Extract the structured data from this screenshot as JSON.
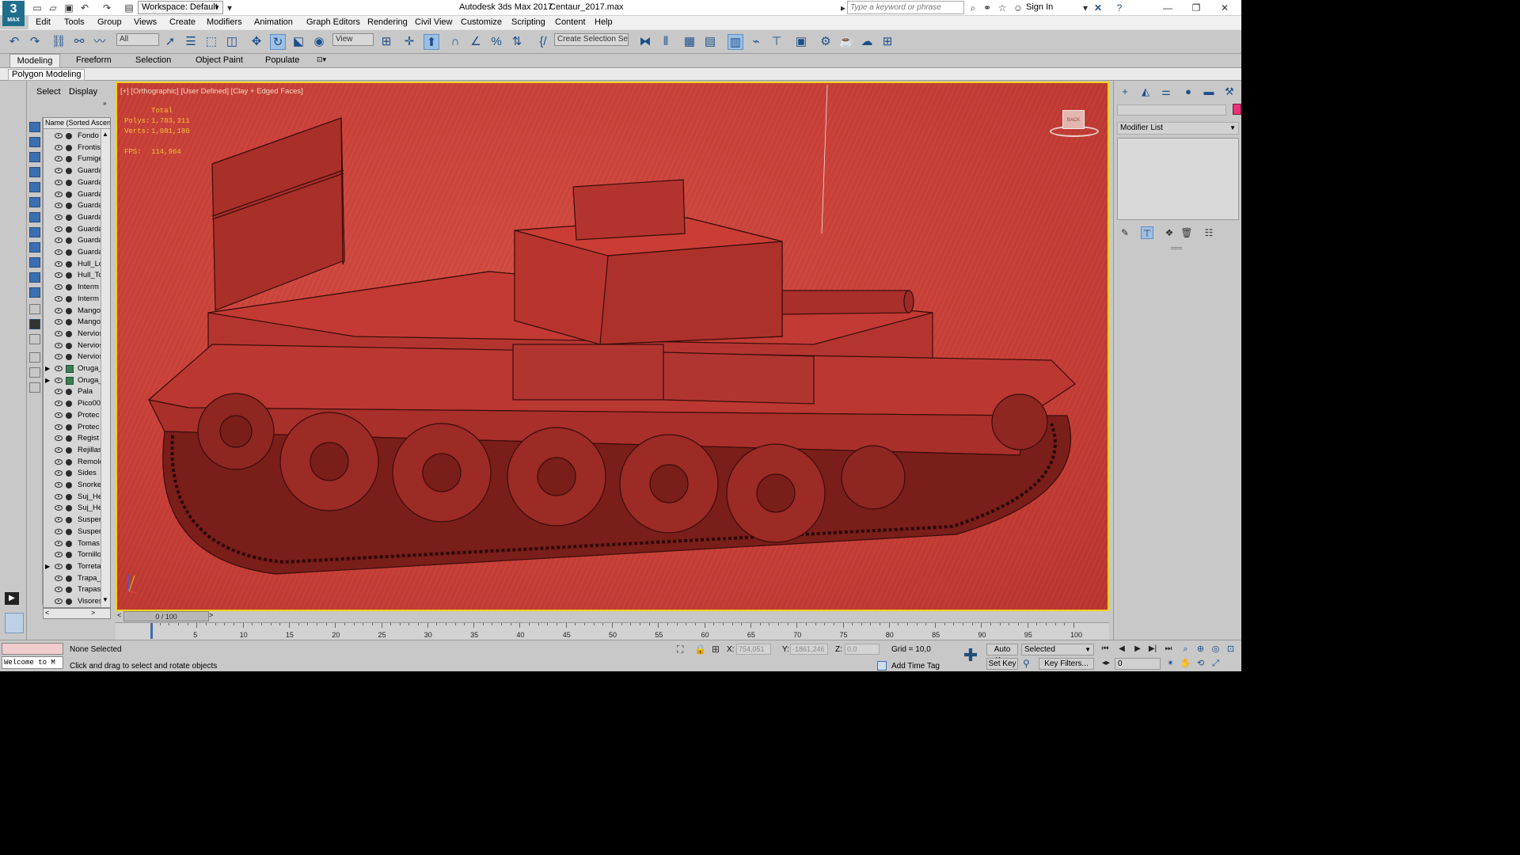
{
  "titlebar": {
    "logo_text": "3",
    "logo_sub": "MAX",
    "workspace": "Workspace: Default",
    "app_title": "Autodesk 3ds Max 2017",
    "file_name": "Centaur_2017.max",
    "search_placeholder": "Type a keyword or phrase",
    "sign_in": "Sign In"
  },
  "menu": [
    "Edit",
    "Tools",
    "Group",
    "Views",
    "Create",
    "Modifiers",
    "Animation",
    "Graph Editors",
    "Rendering",
    "Civil View",
    "Customize",
    "Scripting",
    "Content",
    "Help"
  ],
  "toolbar": {
    "filter_value": "All",
    "refcoord_value": "View",
    "selection_set": "Create Selection Se"
  },
  "ribbon": {
    "tabs": [
      "Modeling",
      "Freeform",
      "Selection",
      "Object Paint",
      "Populate"
    ],
    "panel_label": "Polygon Modeling"
  },
  "explorer": {
    "tab_select": "Select",
    "tab_display": "Display",
    "column_header": "Name (Sorted Ascending)",
    "rows": [
      "Fondo",
      "Frontis",
      "Fumige",
      "Guarda",
      "Guarda",
      "Guarda",
      "Guarda",
      "Guarda",
      "Guarda",
      "Guarda",
      "Guarda",
      "Hull_Lo",
      "Hull_To",
      "Interm",
      "Interm",
      "Mango",
      "Mango",
      "Nervios",
      "Nervios",
      "Nervios",
      "Oruga_",
      "Oruga_",
      "Pala",
      "Pico00",
      "Protec",
      "Protec",
      "Regist",
      "Rejillas",
      "Remolc",
      "Sides",
      "Snorke",
      "Suj_He",
      "Suj_He",
      "Susper",
      "Susper",
      "Tomas",
      "Tornillo",
      "Torreta",
      "Trapa_",
      "Trapas",
      "Visores"
    ]
  },
  "viewport": {
    "label": "[+] [Orthographic] [User Defined] [Clay + Edged Faces]",
    "stats_title": "Total",
    "polys_label": "Polys:",
    "polys_value": "1,783,311",
    "verts_label": "Verts:",
    "verts_value": "1,081,180",
    "fps_label": "FPS:",
    "fps_value": "114,964",
    "viewcube_label": "BACK",
    "background_color": "#c63e36",
    "highlight_color": "#f2d21c"
  },
  "command_panel": {
    "modifier_list": "Modifier List",
    "object_color": "#e8327a"
  },
  "time": {
    "frame_display": "0 / 100",
    "current_frame": 0,
    "ticks": [
      5,
      10,
      15,
      20,
      25,
      30,
      35,
      40,
      45,
      50,
      55,
      60,
      65,
      70,
      75,
      80,
      85,
      90,
      95,
      100
    ]
  },
  "status": {
    "maxscript_text": "Welcome to M",
    "selection": "None Selected",
    "prompt": "Click and drag to select and rotate objects",
    "x_label": "X:",
    "x_value": "754,051",
    "y_label": "Y:",
    "y_value": "-1861,246",
    "z_label": "Z:",
    "z_value": "0,0",
    "grid": "Grid = 10,0",
    "add_time_tag": "Add Time Tag",
    "auto_key": "Auto Key",
    "set_key": "Set Key",
    "selected_combo": "Selected",
    "key_filters": "Key Filters...",
    "frame_field": "0"
  }
}
